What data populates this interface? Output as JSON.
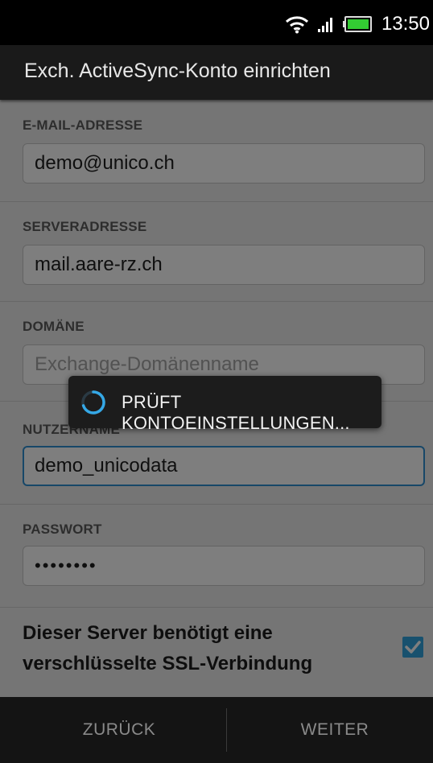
{
  "status_bar": {
    "time": "13:50",
    "icons": [
      "wifi-icon",
      "signal-icon",
      "battery-icon"
    ],
    "battery_color": "#33cc33"
  },
  "action_bar": {
    "title": "Exch. ActiveSync-Konto einrichten"
  },
  "form": {
    "email": {
      "label": "E-MAIL-ADRESSE",
      "value": "demo@unico.ch"
    },
    "server": {
      "label": "SERVERADRESSE",
      "value": "mail.aare-rz.ch"
    },
    "domain": {
      "label": "DOMÄNE",
      "value": "",
      "placeholder": "Exchange-Domänenname"
    },
    "username": {
      "label": "NUTZERNAME",
      "value": "demo_unicodata"
    },
    "password": {
      "label": "PASSWORT",
      "value": "••••••••"
    },
    "ssl": {
      "label": "Dieser Server benötigt eine verschlüsselte SSL-Verbindung",
      "checked": true
    }
  },
  "bottom_bar": {
    "back_label": "ZURÜCK",
    "next_label": "WEITER"
  },
  "progress": {
    "text": "PRÜFT KONTOEINSTELLUNGEN..."
  },
  "colors": {
    "accent": "#31a2dc",
    "focus_border": "#2f8fd1"
  }
}
